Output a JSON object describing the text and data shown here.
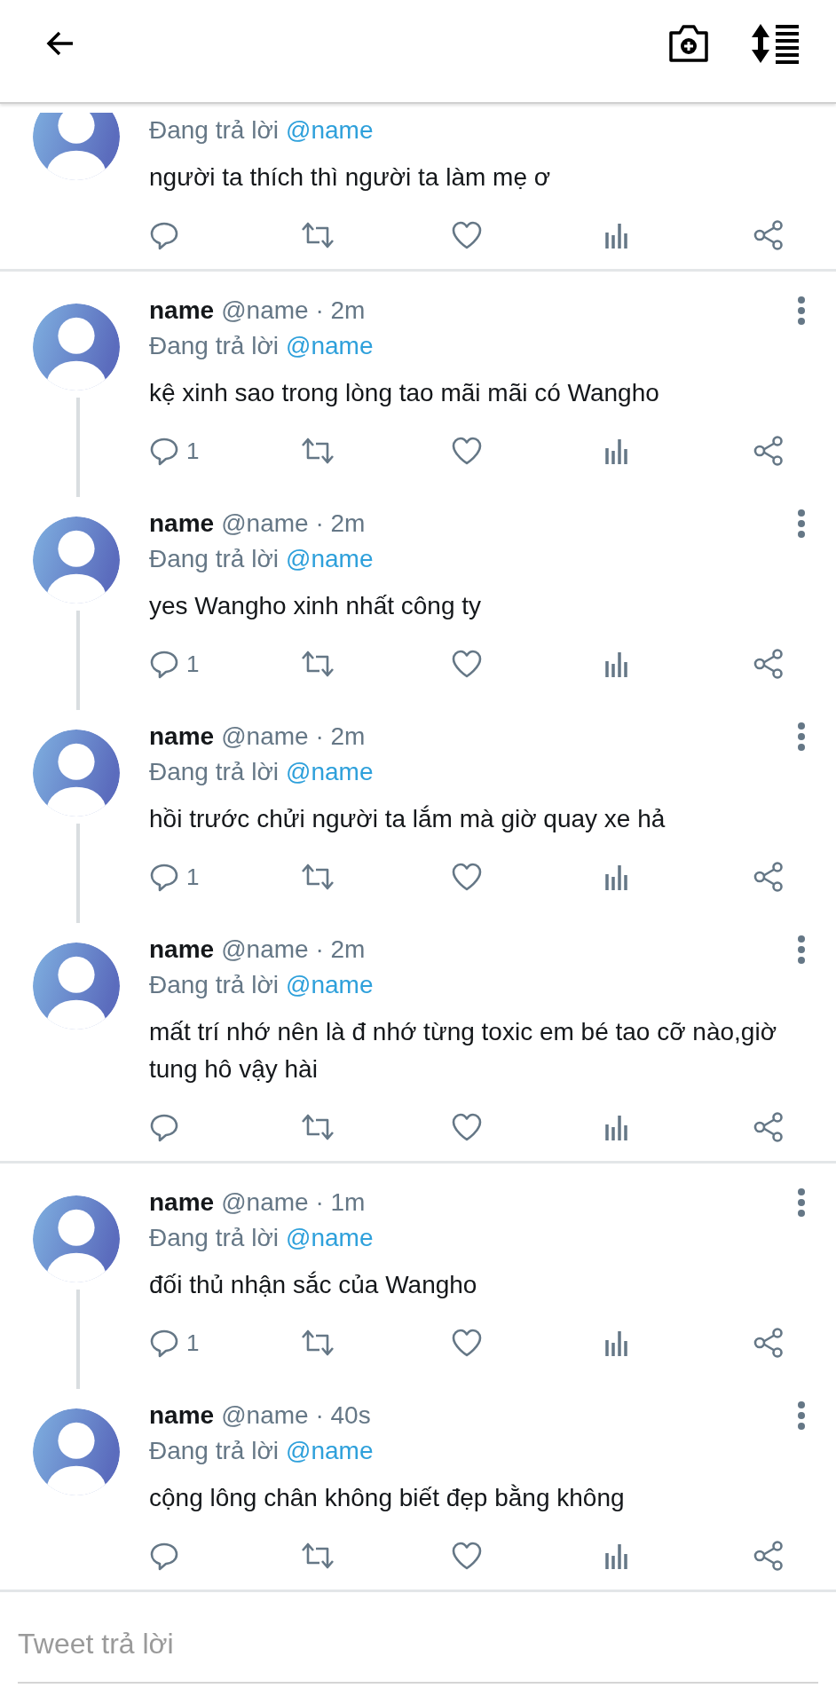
{
  "groups": [
    {
      "tweets": [
        {
          "reply_prefix": "Đang trả lời",
          "reply_to": "@name",
          "text": "người ta thích thì người ta làm mẹ ơ"
        }
      ]
    },
    {
      "tweets": [
        {
          "name": "name",
          "meta": "@name · 2m",
          "reply_prefix": "Đang trả lời",
          "reply_to": "@name",
          "text": "kệ xinh sao trong lòng tao mãi mãi có Wangho",
          "reply_count": "1"
        },
        {
          "name": "name",
          "meta": "@name · 2m",
          "reply_prefix": "Đang trả lời",
          "reply_to": "@name",
          "text": "yes Wangho xinh nhất công ty",
          "reply_count": "1"
        },
        {
          "name": "name",
          "meta": "@name · 2m",
          "reply_prefix": "Đang trả lời",
          "reply_to": "@name",
          "text": "hồi trước chửi người ta lắm mà giờ quay xe hả",
          "reply_count": "1"
        },
        {
          "name": "name",
          "meta": "@name · 2m",
          "reply_prefix": "Đang trả lời",
          "reply_to": "@name",
          "text": "mất trí nhớ nên là đ nhớ từng toxic em bé tao cỡ nào,giờ tung hô vậy hài"
        }
      ]
    },
    {
      "tweets": [
        {
          "name": "name",
          "meta": "@name · 1m",
          "reply_prefix": "Đang trả lời",
          "reply_to": "@name",
          "text": "đối thủ nhận sắc của Wangho",
          "reply_count": "1"
        },
        {
          "name": "name",
          "meta": "@name · 40s",
          "reply_prefix": "Đang trả lời",
          "reply_to": "@name",
          "text": "cộng lông chân không biết đẹp bằng không"
        }
      ]
    }
  ],
  "reply_box": {
    "placeholder": "Tweet trả lời"
  }
}
